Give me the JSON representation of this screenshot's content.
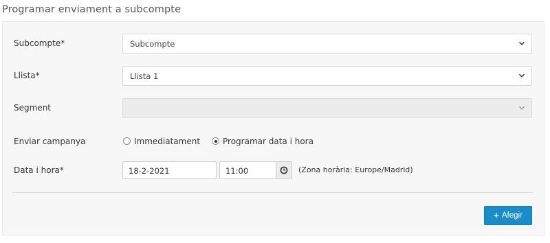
{
  "page": {
    "title": "Programar enviament a subcompte"
  },
  "form": {
    "subaccount": {
      "label": "Subcompte*",
      "value": "Subcompte"
    },
    "list": {
      "label": "Llista*",
      "value": "Llista 1"
    },
    "segment": {
      "label": "Segment",
      "value": ""
    },
    "send": {
      "label": "Enviar campanya",
      "options": [
        {
          "label": "Immediatament",
          "checked": false
        },
        {
          "label": "Programar data i hora",
          "checked": true
        }
      ]
    },
    "datetime": {
      "label": "Data i hora*",
      "date": "18-2-2021",
      "time": "11:00",
      "timezone": "(Zona horària: Europe/Madrid)",
      "clock_icon": "clock-icon"
    }
  },
  "actions": {
    "add_label": "Afegir",
    "add_icon": "plus-icon",
    "accent": "#1a8cc9"
  }
}
